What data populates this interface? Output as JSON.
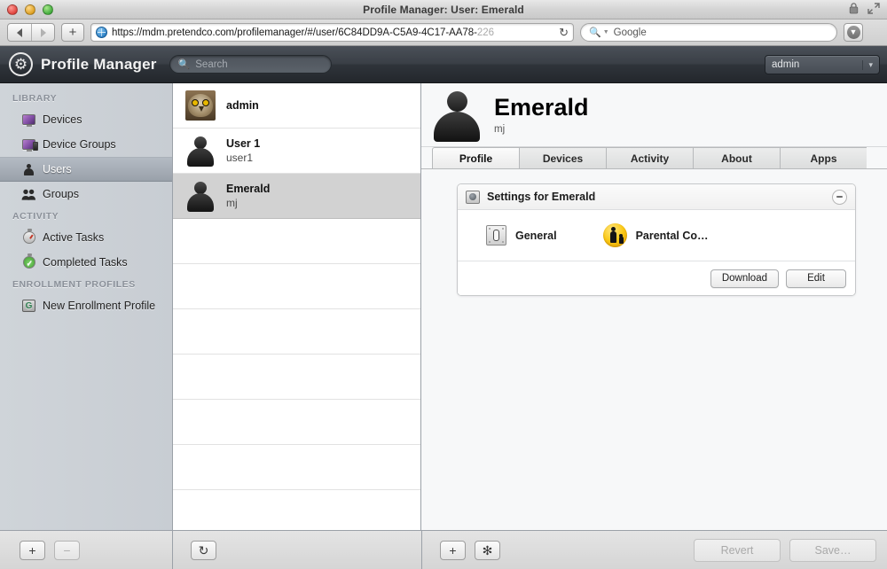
{
  "window": {
    "title": "Profile Manager: User: Emerald",
    "controls": [
      "close",
      "minimize",
      "zoom"
    ],
    "right_icons": [
      "lock-icon",
      "fullscreen-icon"
    ]
  },
  "browser": {
    "back_label": "◀",
    "forward_label": "▶",
    "new_tab_label": "+",
    "url": "https://mdm.pretendco.com/profilemanager/#/user/6C84DD9A-C5A9-4C17-AA78-",
    "url_dim_tail": "226",
    "reload_label": "↻",
    "search_placeholder": "Google",
    "search_icon": "magnifier-icon",
    "downloads_icon": "download-icon"
  },
  "appheader": {
    "logo_icon": "gear-logo-icon",
    "app_name": "Profile Manager",
    "search_placeholder": "Search",
    "search_icon": "search-icon",
    "account": "admin"
  },
  "sidebar": {
    "sections": [
      {
        "label": "LIBRARY",
        "items": [
          {
            "label": "Devices",
            "icon": "monitor-icon",
            "selected": false
          },
          {
            "label": "Device Groups",
            "icon": "monitor-phone-icon",
            "selected": false
          },
          {
            "label": "Users",
            "icon": "person-icon",
            "selected": true
          },
          {
            "label": "Groups",
            "icon": "people-icon",
            "selected": false
          }
        ]
      },
      {
        "label": "ACTIVITY",
        "items": [
          {
            "label": "Active Tasks",
            "icon": "stopwatch-icon",
            "selected": false
          },
          {
            "label": "Completed Tasks",
            "icon": "stopwatch-check-icon",
            "selected": false
          }
        ]
      },
      {
        "label": "ENROLLMENT PROFILES",
        "items": [
          {
            "label": "New Enrollment Profile",
            "icon": "enrollment-card-icon",
            "selected": false
          }
        ]
      }
    ]
  },
  "userlist": {
    "rows": [
      {
        "name": "admin",
        "short": "",
        "avatar": "owl-photo",
        "selected": false
      },
      {
        "name": "User 1",
        "short": "user1",
        "avatar": "person-silhouette",
        "selected": false
      },
      {
        "name": "Emerald",
        "short": "mj",
        "avatar": "person-silhouette",
        "selected": true
      }
    ],
    "empty_rows": 7,
    "refresh_label": "↻"
  },
  "detail": {
    "avatar": "person-silhouette",
    "name": "Emerald",
    "short_name": "mj",
    "tabs": [
      {
        "label": "Profile",
        "active": true
      },
      {
        "label": "Devices",
        "active": false
      },
      {
        "label": "Activity",
        "active": false
      },
      {
        "label": "About",
        "active": false
      },
      {
        "label": "Apps",
        "active": false
      }
    ],
    "panel": {
      "icon": "settings-disc-icon",
      "title": "Settings for Emerald",
      "collapse_label": "−",
      "payloads": [
        {
          "label": "General",
          "icon": "general-icon"
        },
        {
          "label": "Parental Co…",
          "icon": "parental-controls-icon"
        }
      ],
      "buttons": [
        {
          "label": "Download",
          "disabled": false
        },
        {
          "label": "Edit",
          "disabled": false
        }
      ]
    }
  },
  "bottombar": {
    "left": [
      {
        "label": "+",
        "name": "add-user-button",
        "disabled": false
      },
      {
        "label": "−",
        "name": "remove-user-button",
        "disabled": true
      }
    ],
    "middle": [
      {
        "label": "↻",
        "name": "refresh-list-button",
        "disabled": false
      }
    ],
    "right_tools": [
      {
        "label": "+",
        "name": "add-payload-button",
        "disabled": false
      },
      {
        "label": "✻",
        "name": "action-gear-button",
        "disabled": false
      }
    ],
    "actions": [
      {
        "label": "Revert",
        "name": "revert-button",
        "disabled": true
      },
      {
        "label": "Save…",
        "name": "save-button",
        "disabled": true
      }
    ]
  },
  "colors": {
    "header_dark": "#2f343a",
    "sidebar": "#cbd0d6",
    "selection_gray": "#d2d2d2",
    "parental_yellow": "#fbc916"
  }
}
